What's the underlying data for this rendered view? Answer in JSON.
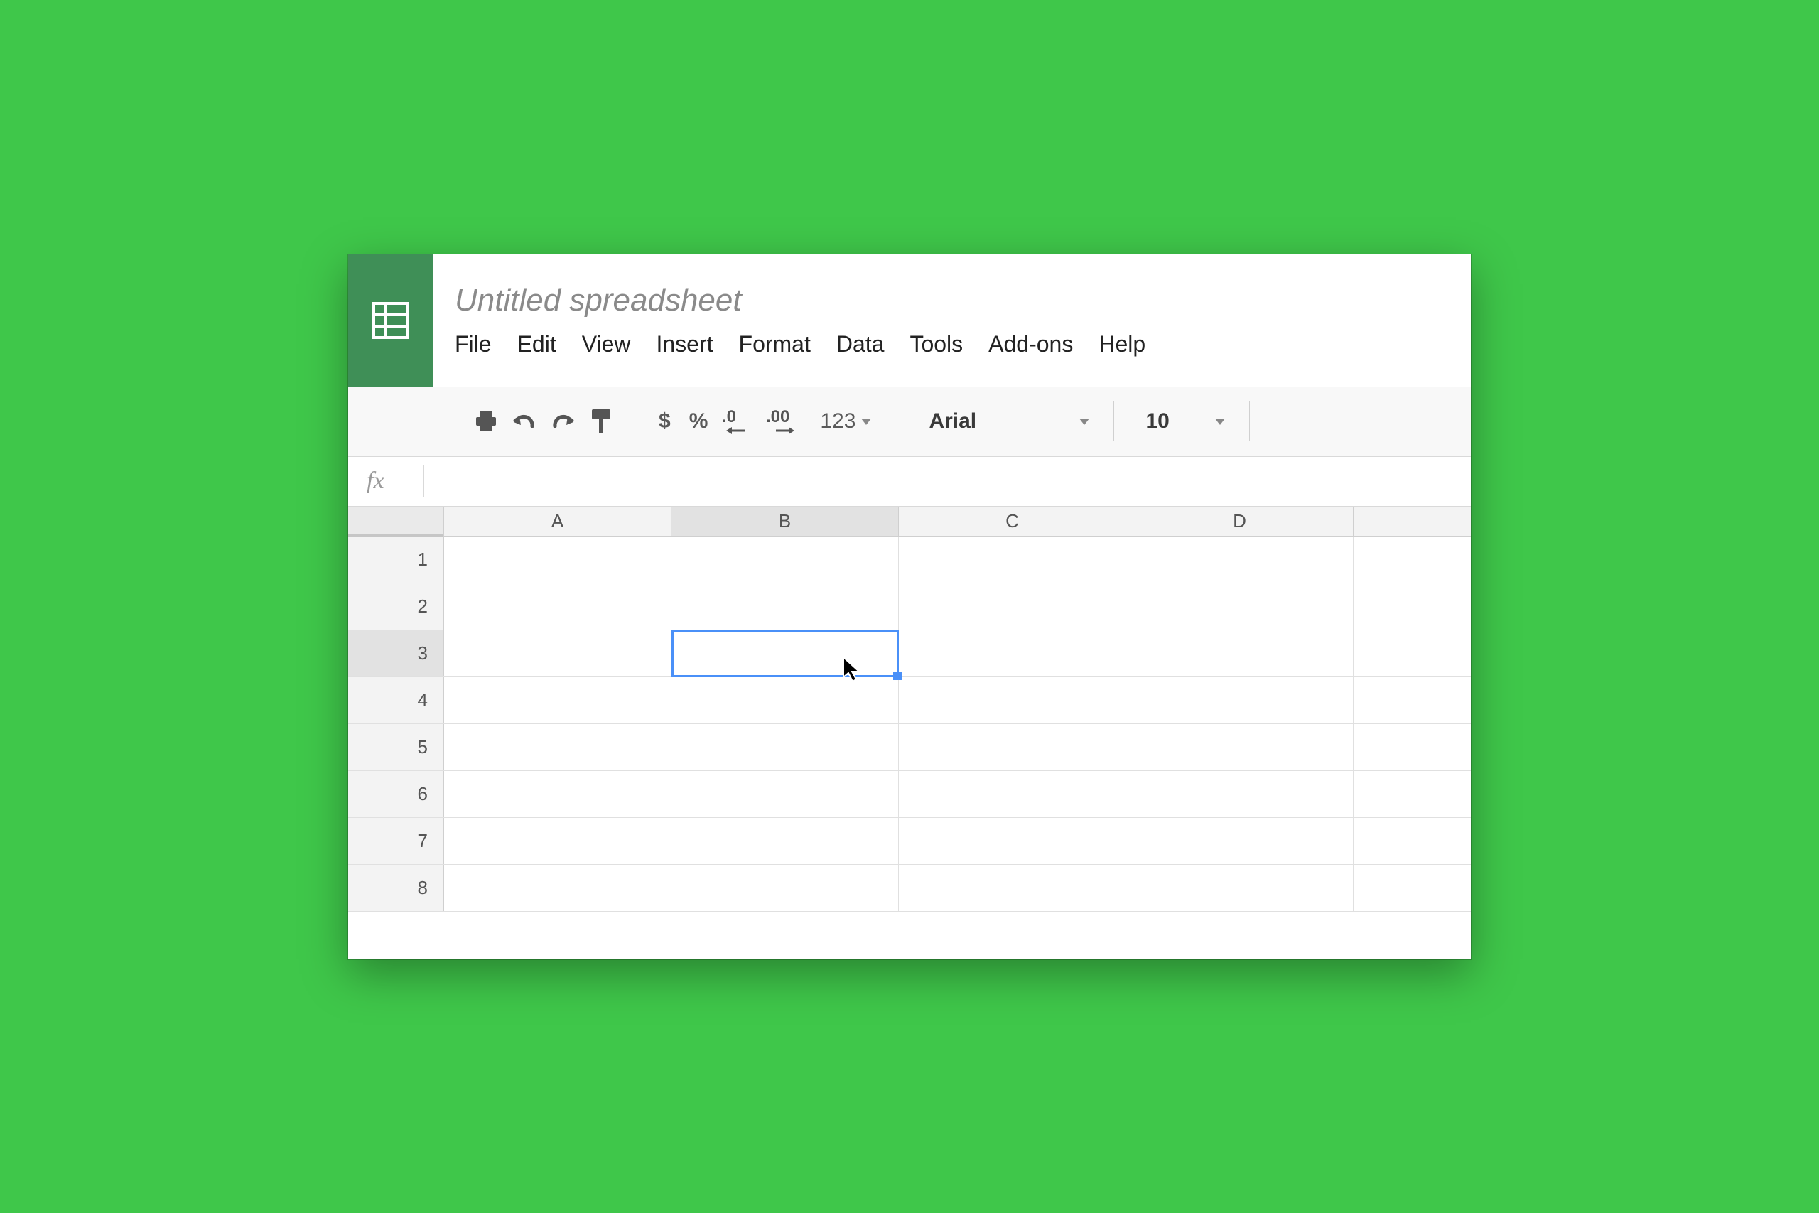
{
  "doc": {
    "title": "Untitled spreadsheet"
  },
  "menu": {
    "file": "File",
    "edit": "Edit",
    "view": "View",
    "insert": "Insert",
    "format": "Format",
    "data": "Data",
    "tools": "Tools",
    "addons": "Add-ons",
    "help": "Help"
  },
  "toolbar": {
    "currency": "$",
    "percent": "%",
    "decrease_decimal": ".0",
    "increase_decimal": ".00",
    "more_formats": "123",
    "font": "Arial",
    "font_size": "10"
  },
  "formula": {
    "label": "fx",
    "value": ""
  },
  "columns": [
    "A",
    "B",
    "C",
    "D"
  ],
  "rows": [
    "1",
    "2",
    "3",
    "4",
    "5",
    "6",
    "7",
    "8"
  ],
  "selection": {
    "cell": "B3",
    "col_index": 1,
    "row_index": 2
  },
  "colors": {
    "accent": "#4a90f8",
    "brand": "#3f8f57",
    "background": "#3fc74a"
  }
}
